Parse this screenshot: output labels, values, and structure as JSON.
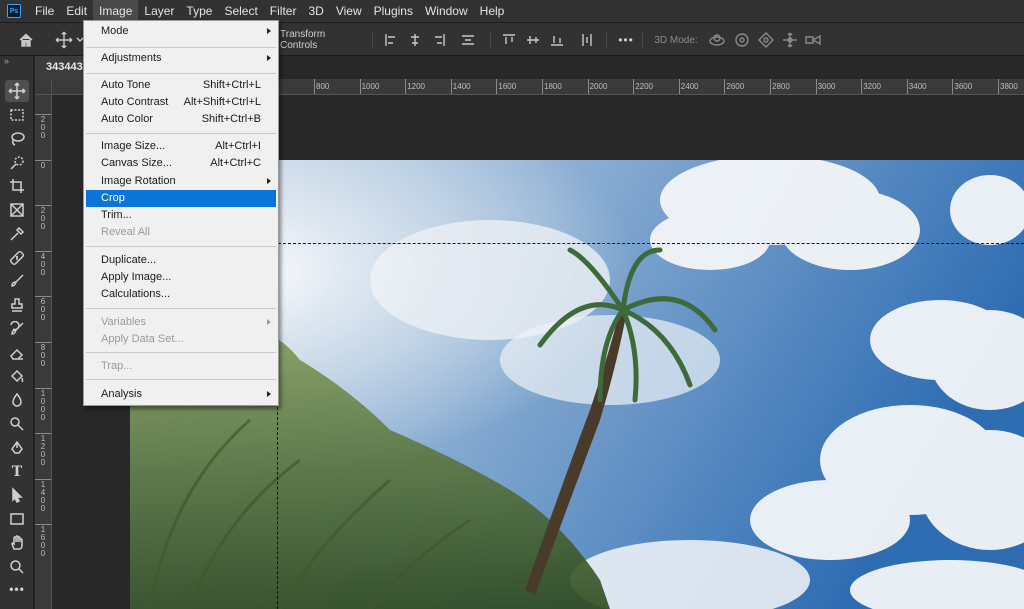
{
  "menubar": {
    "logo": "Ps",
    "items": [
      "File",
      "Edit",
      "Image",
      "Layer",
      "Type",
      "Select",
      "Filter",
      "3D",
      "View",
      "Plugins",
      "Window",
      "Help"
    ],
    "active_item": "Image"
  },
  "options_bar": {
    "transform_controls_label": "Transform Controls",
    "mode_3d_label": "3D Mode:",
    "more_label": "•••"
  },
  "document": {
    "tab_title": "343443",
    "ruler_top_labels": [
      "800",
      "1000",
      "1200",
      "1400",
      "1600",
      "1800",
      "2000",
      "2200",
      "2400",
      "2600",
      "2800",
      "3000",
      "3200",
      "3400",
      "3600",
      "3800"
    ],
    "ruler_left_labels": [
      "200",
      "0",
      "200",
      "400",
      "600",
      "800",
      "1000",
      "1200",
      "1400",
      "1600"
    ]
  },
  "image_menu": {
    "items": {
      "mode": {
        "label": "Mode"
      },
      "adjustments": {
        "label": "Adjustments"
      },
      "auto_tone": {
        "label": "Auto Tone",
        "shortcut": "Shift+Ctrl+L"
      },
      "auto_contrast": {
        "label": "Auto Contrast",
        "shortcut": "Alt+Shift+Ctrl+L"
      },
      "auto_color": {
        "label": "Auto Color",
        "shortcut": "Shift+Ctrl+B"
      },
      "image_size": {
        "label": "Image Size...",
        "shortcut": "Alt+Ctrl+I"
      },
      "canvas_size": {
        "label": "Canvas Size...",
        "shortcut": "Alt+Ctrl+C"
      },
      "image_rotation": {
        "label": "Image Rotation"
      },
      "crop": {
        "label": "Crop"
      },
      "trim": {
        "label": "Trim..."
      },
      "reveal_all": {
        "label": "Reveal All"
      },
      "duplicate": {
        "label": "Duplicate..."
      },
      "apply_image": {
        "label": "Apply Image..."
      },
      "calculations": {
        "label": "Calculations..."
      },
      "variables": {
        "label": "Variables"
      },
      "apply_data_set": {
        "label": "Apply Data Set..."
      },
      "trap": {
        "label": "Trap..."
      },
      "analysis": {
        "label": "Analysis"
      }
    },
    "highlighted": "Crop"
  },
  "colors": {
    "highlight": "#0a74d8",
    "app_bg": "#282828",
    "panel_bg": "#323232"
  }
}
